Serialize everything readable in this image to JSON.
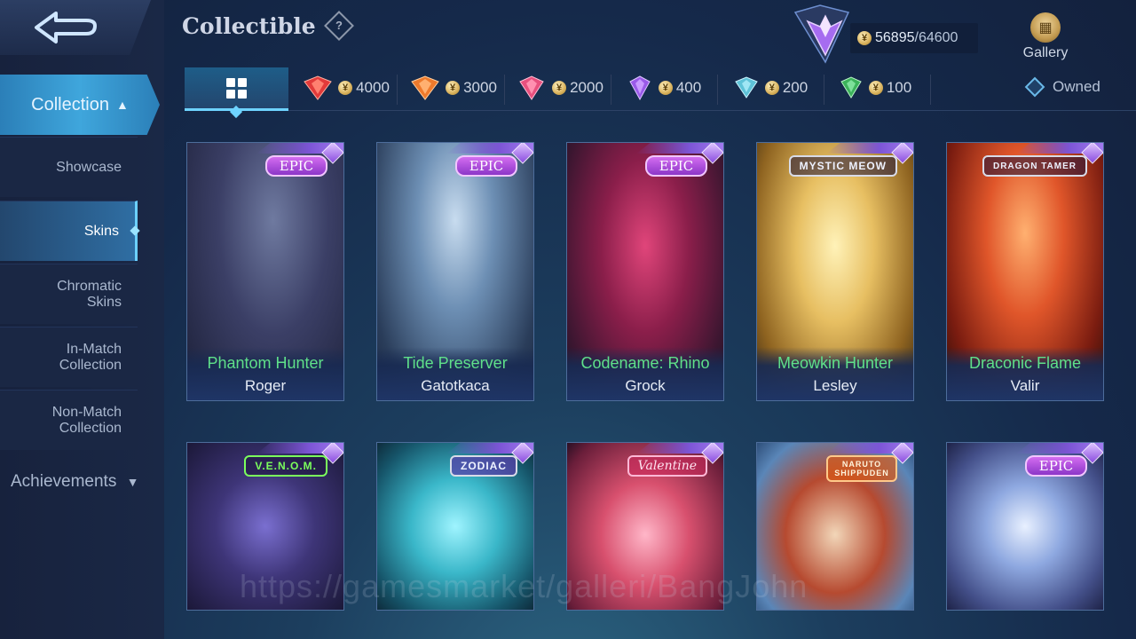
{
  "sidebar": {
    "collection_label": "Collection",
    "items": [
      {
        "label": "Showcase",
        "active": false
      },
      {
        "label": "Skins",
        "active": true
      },
      {
        "label": "Chromatic Skins",
        "active": false
      },
      {
        "label": "In-Match Collection",
        "active": false
      },
      {
        "label": "Non-Match Collection",
        "active": false
      }
    ],
    "achievements_label": "Achievements"
  },
  "header": {
    "title": "Collectible",
    "help_symbol": "?",
    "currency_current": "56895",
    "currency_total": "/64600",
    "gallery_label": "Gallery"
  },
  "tabs": [
    {
      "icon": "grid-icon",
      "active": true
    },
    {
      "icon": "red-gem-icon",
      "price": "4000",
      "color": "#e23a3a"
    },
    {
      "icon": "orange-gem-icon",
      "price": "3000",
      "color": "#ee7a2c"
    },
    {
      "icon": "pink-gem-icon",
      "price": "2000",
      "color": "#e8507e"
    },
    {
      "icon": "purple-gem-icon",
      "price": "400",
      "color": "#9a5ae8"
    },
    {
      "icon": "teal-gem-icon",
      "price": "200",
      "color": "#5ec3d8"
    },
    {
      "icon": "green-gem-icon",
      "price": "100",
      "color": "#3cb25a"
    }
  ],
  "owned_label": "Owned",
  "cards": [
    {
      "badge": "EPIC",
      "skin": "Phantom Hunter",
      "hero": "Roger"
    },
    {
      "badge": "EPIC",
      "skin": "Tide Preserver",
      "hero": "Gatotkaca"
    },
    {
      "badge": "EPIC",
      "skin": "Codename: Rhino",
      "hero": "Grock"
    },
    {
      "badge": "MYSTIC MEOW",
      "skin": "Meowkin Hunter",
      "hero": "Lesley"
    },
    {
      "badge": "DRAGON TAMER",
      "skin": "Draconic Flame",
      "hero": "Valir"
    },
    {
      "badge": "V.E.N.O.M.",
      "skin": "",
      "hero": ""
    },
    {
      "badge": "ZODIAC",
      "skin": "",
      "hero": ""
    },
    {
      "badge": "Valentine",
      "skin": "",
      "hero": ""
    },
    {
      "badge": "NARUTO SHIPPUDEN",
      "skin": "",
      "hero": ""
    },
    {
      "badge": "EPIC",
      "skin": "",
      "hero": ""
    }
  ],
  "watermark": "https://gamesmarket/galleri/BangJohn"
}
